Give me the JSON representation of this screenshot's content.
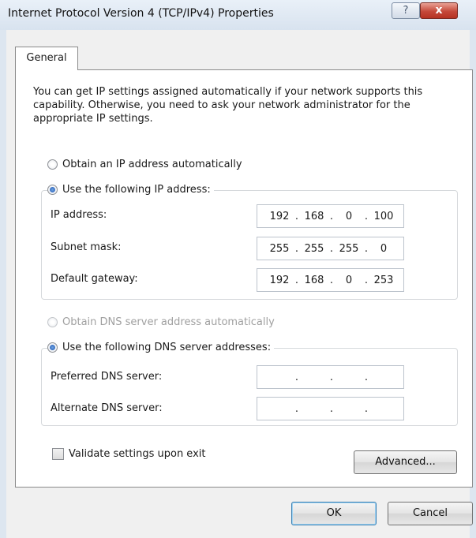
{
  "window": {
    "title": "Internet Protocol Version 4 (TCP/IPv4) Properties",
    "help_label": "?",
    "close_label": "x"
  },
  "tabs": [
    {
      "label": "General",
      "selected": true
    }
  ],
  "description": "You can get IP settings assigned automatically if your network supports this capability. Otherwise, you need to ask your network administrator for the appropriate IP settings.",
  "ip_section": {
    "auto_label": "Obtain an IP address automatically",
    "auto_selected": false,
    "manual_label": "Use the following IP address:",
    "manual_selected": true,
    "fields": [
      {
        "label": "IP address:",
        "octets": [
          "192",
          "168",
          "0",
          "100"
        ]
      },
      {
        "label": "Subnet mask:",
        "octets": [
          "255",
          "255",
          "255",
          "0"
        ]
      },
      {
        "label": "Default gateway:",
        "octets": [
          "192",
          "168",
          "0",
          "253"
        ]
      }
    ]
  },
  "dns_section": {
    "auto_label": "Obtain DNS server address automatically",
    "auto_selected": false,
    "auto_enabled": false,
    "manual_label": "Use the following DNS server addresses:",
    "manual_selected": true,
    "fields": [
      {
        "label": "Preferred DNS server:",
        "octets": [
          "",
          "",
          "",
          ""
        ]
      },
      {
        "label": "Alternate DNS server:",
        "octets": [
          "",
          "",
          "",
          ""
        ]
      }
    ]
  },
  "validate": {
    "label": "Validate settings upon exit",
    "checked": false
  },
  "buttons": {
    "advanced": "Advanced...",
    "ok": "OK",
    "cancel": "Cancel"
  }
}
